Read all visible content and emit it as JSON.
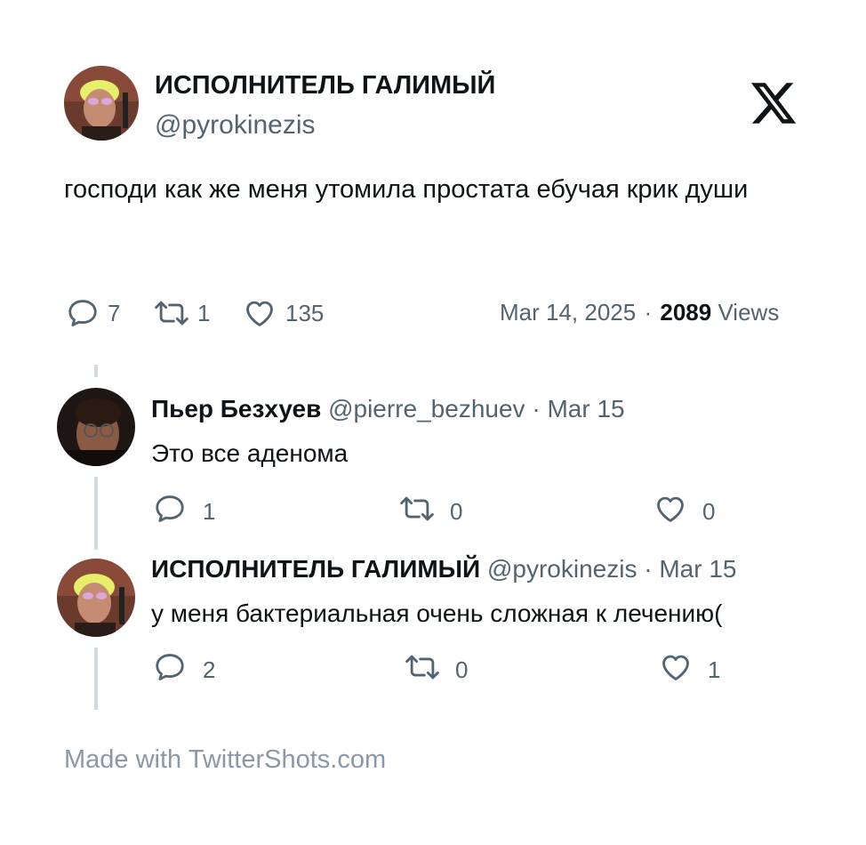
{
  "tweet": {
    "author_name": "ИСПОЛНИТЕЛЬ ГАЛИМЫЙ",
    "author_handle": "@pyrokinezis",
    "text": "господи как же меня утомила простата ебучая крик души",
    "stats": {
      "replies": "7",
      "retweets": "1",
      "likes": "135"
    },
    "date": "Mar 14, 2025",
    "separator": "·",
    "views_count": "2089",
    "views_label": "Views"
  },
  "replies": [
    {
      "name": "Пьер Безхуев",
      "handle": "@pierre_bezhuev",
      "separator": "·",
      "date": "Mar 15",
      "text": "Это все аденома",
      "stats": {
        "replies": "1",
        "retweets": "0",
        "likes": "0"
      }
    },
    {
      "name": "ИСПОЛНИТЕЛЬ ГАЛИМЫЙ",
      "handle": "@pyrokinezis",
      "separator": "·",
      "date": "Mar 15",
      "text": "у меня бактериальная очень сложная к лечению(",
      "stats": {
        "replies": "2",
        "retweets": "0",
        "likes": "1"
      }
    }
  ],
  "footer": {
    "text": "Made with TwitterShots.com"
  },
  "icons": {
    "brand": "x-logo-icon",
    "reply": "reply-icon",
    "retweet": "retweet-icon",
    "like": "heart-icon"
  },
  "colors": {
    "text": "#0f1419",
    "secondary": "#536471",
    "thread": "#cfd9de"
  }
}
